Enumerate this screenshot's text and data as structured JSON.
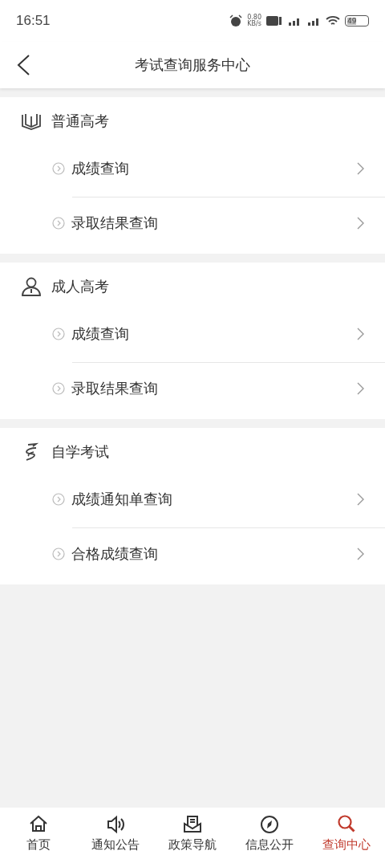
{
  "status_bar": {
    "time": "16:51",
    "net_speed": "0.80",
    "net_unit": "KB/s",
    "battery": "49"
  },
  "header": {
    "title": "考试查询服务中心"
  },
  "sections": [
    {
      "kind": "book",
      "title": "普通高考",
      "items": [
        {
          "label": "成绩查询"
        },
        {
          "label": "录取结果查询"
        }
      ]
    },
    {
      "kind": "person",
      "title": "成人高考",
      "items": [
        {
          "label": "成绩查询"
        },
        {
          "label": "录取结果查询"
        }
      ]
    },
    {
      "kind": "spiral",
      "title": "自学考试",
      "items": [
        {
          "label": "成绩通知单查询"
        },
        {
          "label": "合格成绩查询"
        }
      ]
    }
  ],
  "tabs": [
    {
      "kind": "home",
      "label": "首页",
      "selected": false
    },
    {
      "kind": "speaker",
      "label": "通知公告",
      "selected": false
    },
    {
      "kind": "mail",
      "label": "政策导航",
      "selected": false
    },
    {
      "kind": "compass",
      "label": "信息公开",
      "selected": false
    },
    {
      "kind": "search",
      "label": "查询中心",
      "selected": true
    }
  ]
}
